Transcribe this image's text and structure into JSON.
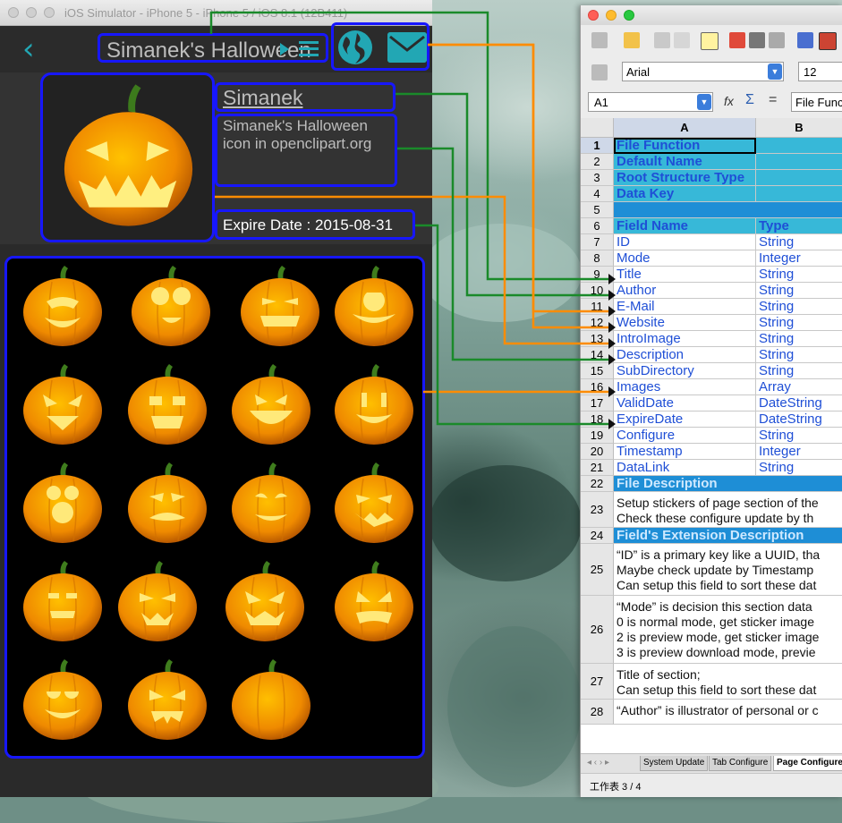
{
  "simulator": {
    "window_title": "iOS Simulator - iPhone 5 - iPhone 5 / iOS 8.1 (12B411)",
    "nav_title": "Simanek's Halloween",
    "back_label": "‹",
    "header": {
      "name": "Simanek",
      "description": "Simanek's Halloween icon in openclipart.org",
      "expire": "Expire Date : 2015-08-31"
    },
    "sticker_count": 19
  },
  "spreadsheet": {
    "font_name": "Arial",
    "font_size": "12",
    "cell_ref": "A1",
    "formula": "File Function",
    "columns": [
      "A",
      "B"
    ],
    "rows": [
      {
        "n": "1",
        "a": "File Function",
        "b": "",
        "style": "hdr"
      },
      {
        "n": "2",
        "a": "Default Name",
        "b": "",
        "style": "hdr"
      },
      {
        "n": "3",
        "a": "Root Structure Type",
        "b": "",
        "style": "hdr"
      },
      {
        "n": "4",
        "a": "Data Key",
        "b": "",
        "style": "hdr"
      },
      {
        "n": "5",
        "a": "",
        "b": "",
        "style": "sec"
      },
      {
        "n": "6",
        "a": "Field Name",
        "b": "Type",
        "style": "hdr"
      },
      {
        "n": "7",
        "a": "ID",
        "b": "String",
        "style": "plain"
      },
      {
        "n": "8",
        "a": "Mode",
        "b": "Integer",
        "style": "plain"
      },
      {
        "n": "9",
        "a": "Title",
        "b": "String",
        "style": "plain"
      },
      {
        "n": "10",
        "a": "Author",
        "b": "String",
        "style": "plain"
      },
      {
        "n": "11",
        "a": "E-Mail",
        "b": "String",
        "style": "plain"
      },
      {
        "n": "12",
        "a": "Website",
        "b": "String",
        "style": "plain"
      },
      {
        "n": "13",
        "a": "IntroImage",
        "b": "String",
        "style": "plain"
      },
      {
        "n": "14",
        "a": "Description",
        "b": "String",
        "style": "plain"
      },
      {
        "n": "15",
        "a": "SubDirectory",
        "b": "String",
        "style": "plain"
      },
      {
        "n": "16",
        "a": "Images",
        "b": "Array",
        "style": "plain"
      },
      {
        "n": "17",
        "a": "ValidDate",
        "b": "DateString",
        "style": "plain"
      },
      {
        "n": "18",
        "a": "ExpireDate",
        "b": "DateString",
        "style": "plain"
      },
      {
        "n": "19",
        "a": "Configure",
        "b": "String",
        "style": "plain"
      },
      {
        "n": "20",
        "a": "Timestamp",
        "b": "Integer",
        "style": "plain"
      },
      {
        "n": "21",
        "a": "DataLink",
        "b": "String",
        "style": "plain"
      },
      {
        "n": "22",
        "a": "File Description",
        "b": "",
        "style": "sec"
      },
      {
        "n": "23",
        "a": "Setup stickers of page section of the\nCheck these configure update by th",
        "b": "",
        "style": "txt"
      },
      {
        "n": "24",
        "a": "Field's Extension Description",
        "b": "",
        "style": "sec"
      },
      {
        "n": "25",
        "a": "“ID” is a primary key like a UUID, tha\nMaybe check update by Timestamp\nCan setup this field to sort these dat",
        "b": "",
        "style": "txt"
      },
      {
        "n": "26",
        "a": "“Mode” is decision this section data\n0 is normal mode, get sticker image\n2 is preview mode, get sticker image\n3 is preview download mode, previe",
        "b": "",
        "style": "txt"
      },
      {
        "n": "27",
        "a": "Title of section;\nCan setup this field to sort these dat",
        "b": "",
        "style": "txt"
      },
      {
        "n": "28",
        "a": "“Author” is illustrator of personal or c",
        "b": "",
        "style": "txt"
      }
    ],
    "tabs": [
      "System Update",
      "Tab Configure",
      "Page Configure"
    ],
    "active_tab": "Page Configure",
    "status": "工作表 3 / 4"
  },
  "colors": {
    "accent": "#22a7b4",
    "highlight_border": "#1717ff",
    "connector_green": "#1a8a2a",
    "connector_orange": "#ff8c00"
  }
}
